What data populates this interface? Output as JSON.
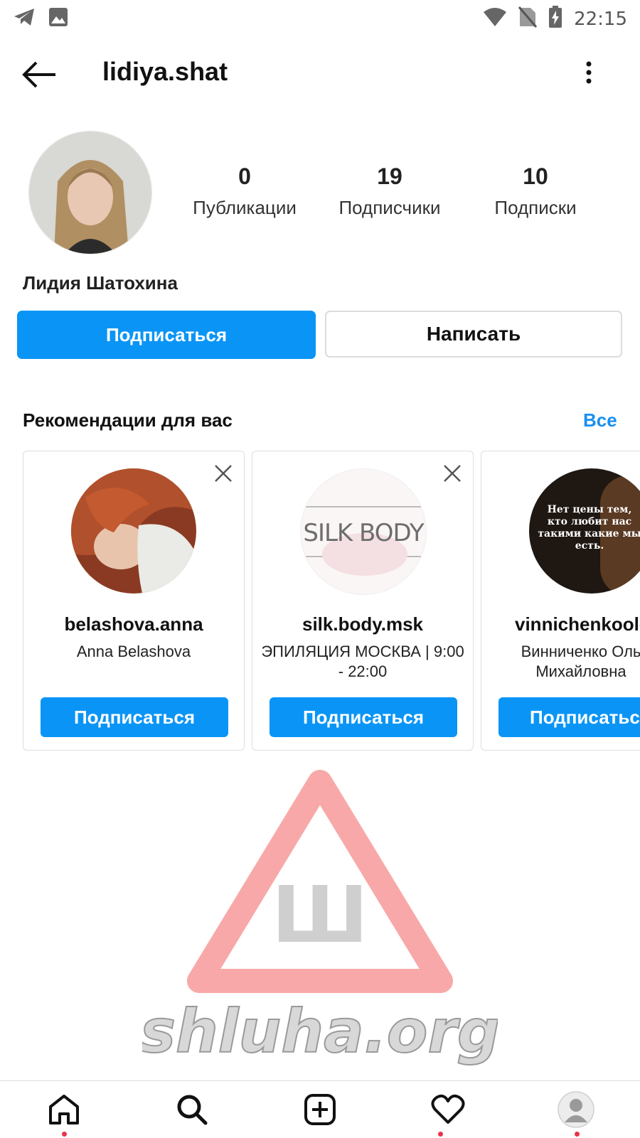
{
  "status_bar": {
    "time": "22:15",
    "icons": [
      "telegram-icon",
      "gallery-icon",
      "wifi-icon",
      "no-sim-icon",
      "battery-charging-icon"
    ]
  },
  "header": {
    "username": "lidiya.shat",
    "icons": [
      "back-arrow-icon",
      "more-options-icon"
    ]
  },
  "profile": {
    "full_name": "Лидия Шатохина",
    "stats": [
      {
        "value": "0",
        "label": "Публикации"
      },
      {
        "value": "19",
        "label": "Подписчики"
      },
      {
        "value": "10",
        "label": "Подписки"
      }
    ],
    "follow_label": "Подписаться",
    "message_label": "Написать"
  },
  "recommendations": {
    "title": "Рекомендации для вас",
    "see_all": "Все",
    "cards": [
      {
        "handle": "belashova.anna",
        "subtitle": "Anna Belashova",
        "button": "Подписаться"
      },
      {
        "handle": "silk.body.msk",
        "subtitle": "ЭПИЛЯЦИЯ МОСКВА | 9:00 - 22:00",
        "button": "Подписаться",
        "avatar_text": "SILK BODY"
      },
      {
        "handle": "vinnichenkoolg",
        "subtitle": "Винниченко Оль Михайловна",
        "button": "Подписатьс",
        "avatar_text": "Нет цены тем, кто любит нас такими какие мы есть."
      }
    ]
  },
  "watermark": {
    "letter": "Ш",
    "text": "shluha.org"
  },
  "bottom_nav": {
    "items": [
      "home-icon",
      "search-icon",
      "add-post-icon",
      "activity-heart-icon",
      "profile-avatar-icon"
    ]
  },
  "colors": {
    "accent": "#0a95f6",
    "link": "#1a8ff0",
    "notification_dot": "#e8334a"
  }
}
